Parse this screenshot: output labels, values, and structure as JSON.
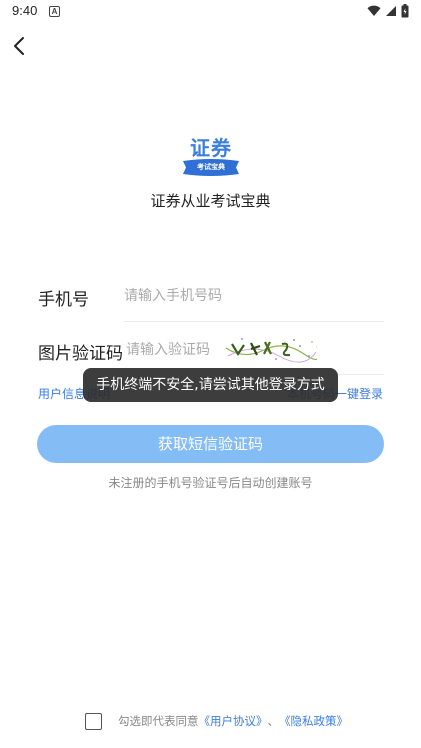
{
  "status_bar": {
    "time": "9:40",
    "notification_badge": "A"
  },
  "header": {
    "back_icon": "chevron-left-icon"
  },
  "logo": {
    "title": "证券",
    "ribbon_text": "考试宝典"
  },
  "app_name": "证券从业考试宝典",
  "form": {
    "phone_label": "手机号",
    "phone_placeholder": "请输入手机号码",
    "captcha_label": "图片验证码",
    "captcha_placeholder": "请输入验证码"
  },
  "links": {
    "user_info": "用户信息说明",
    "one_click_login": "本机号码一键登录"
  },
  "toast": "手机终端不安全,请尝试其他登录方式",
  "sms_button": "获取短信验证码",
  "hint": "未注册的手机号验证号后自动创建账号",
  "agreement": {
    "prefix": "勾选即代表同意",
    "user_agreement": "《用户协议》",
    "separator": "、",
    "privacy_policy": "《隐私政策》"
  },
  "colors": {
    "accent": "#3b7ce0",
    "button": "#84bdf6",
    "toast_bg": "#2c2c2c"
  }
}
